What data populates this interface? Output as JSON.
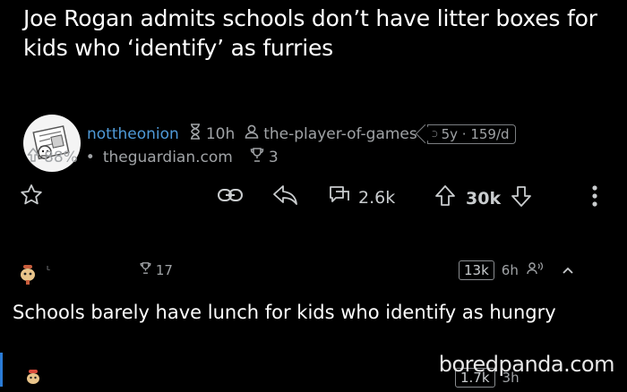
{
  "post": {
    "title": "Joe Rogan admits schools don’t have litter boxes for kids who ‘identify’ as furries",
    "subreddit": "nottheonion",
    "age": "10h",
    "author": "the-player-of-games",
    "author_badge": "5y · 159/d",
    "upvote_ratio": "88%",
    "domain": "theguardian.com",
    "awards": "3"
  },
  "actions": {
    "comments": "2.6k",
    "score": "30k"
  },
  "comment1": {
    "username": "ᴸ",
    "awards": "17",
    "score": "13k",
    "age": "6h",
    "text": "Schools barely have lunch for kids who identify as hungry"
  },
  "comment2": {
    "score": "1.7k",
    "age": "3h"
  },
  "watermark": "boredpanda.com",
  "colors": {
    "background": "#000000",
    "subreddit": "#4f9ad8",
    "reply_bar": "#2a7bd6"
  }
}
